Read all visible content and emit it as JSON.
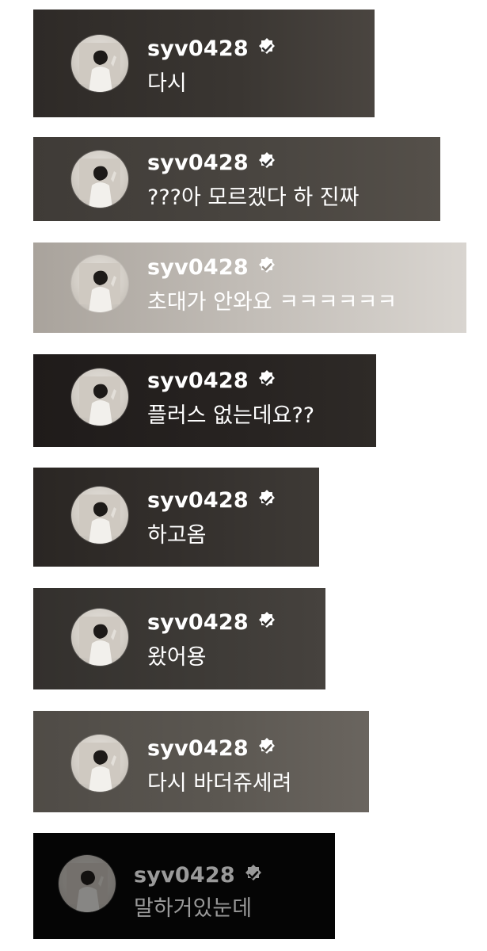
{
  "comments": [
    {
      "username": "syv0428",
      "text": "다시",
      "bg": "#34302c"
    },
    {
      "username": "syv0428",
      "text": "???아 모르겠다 하 진짜",
      "bg": "#433f3a"
    },
    {
      "username": "syv0428",
      "text": "초대가 안와요 ㅋㅋㅋㅋㅋㅋ",
      "bg": "#b8b2ac"
    },
    {
      "username": "syv0428",
      "text": "플러스 없는데요??",
      "bg": "#231f1e"
    },
    {
      "username": "syv0428",
      "text": "하고옴",
      "bg": "#2f2b28"
    },
    {
      "username": "syv0428",
      "text": "왔어용",
      "bg": "#3a3633"
    },
    {
      "username": "syv0428",
      "text": "다시 바더쥬세려",
      "bg": "#57534e"
    },
    {
      "username": "syv0428",
      "text": "말하거있눈데",
      "bg": "#050505"
    }
  ],
  "verified_icon": "verified-check-icon",
  "avatar_icon": "profile-photo"
}
